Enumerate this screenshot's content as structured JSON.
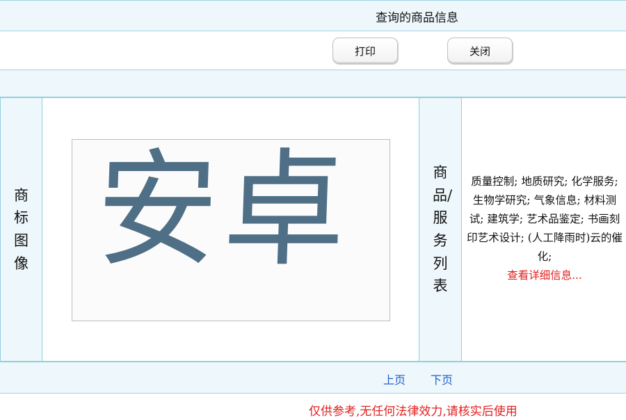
{
  "header": {
    "title": "查询的商品信息"
  },
  "toolbar": {
    "print_label": "打印",
    "close_label": "关闭"
  },
  "main": {
    "image_label": "商标图像",
    "mark_text": "安卓",
    "services_label": "商品/服务列表",
    "services_text": "质量控制; 地质研究; 化学服务; 生物学研究; 气象信息; 材料测试; 建筑学; 艺术品鉴定; 书画刻印艺术设计; (人工降雨时)云的催化;",
    "more_link": "查看详细信息..."
  },
  "pager": {
    "prev": "上页",
    "next": "下页"
  },
  "footer": {
    "disclaimer": "仅供参考,无任何法律效力,请核实后使用"
  },
  "colors": {
    "accent_border": "#8fd0e0",
    "band_bg": "#eef7fb",
    "link": "#1f5fd0",
    "warning": "#e02020"
  }
}
